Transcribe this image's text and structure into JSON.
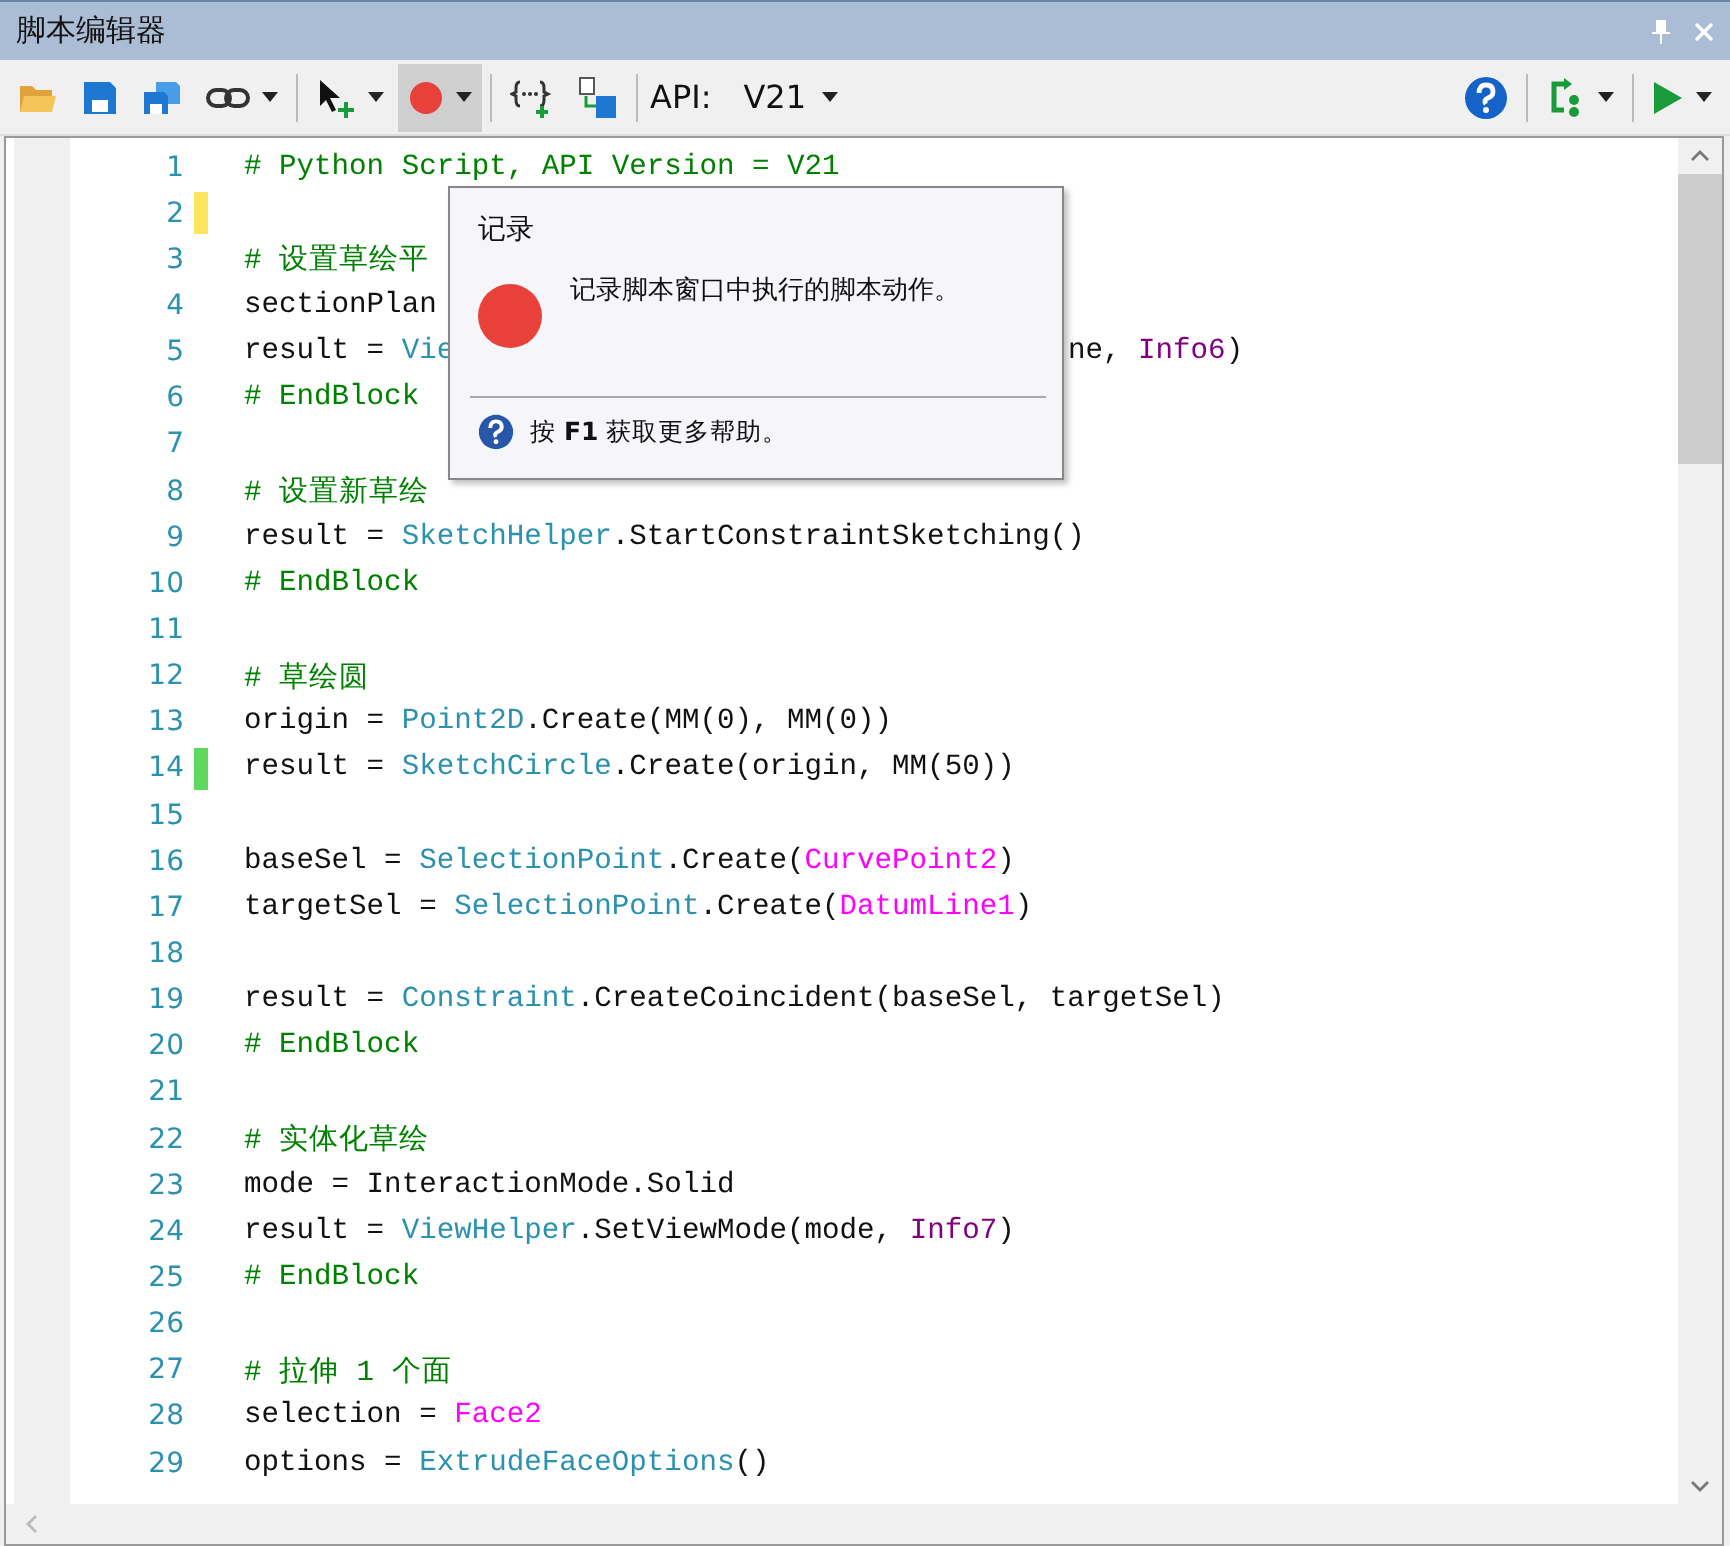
{
  "window": {
    "title": "脚本编辑器"
  },
  "toolbar": [
    {
      "kind": "open",
      "dropdown": false,
      "pressed": false
    },
    {
      "kind": "save",
      "dropdown": false,
      "pressed": false
    },
    {
      "kind": "saveall",
      "dropdown": false,
      "pressed": false
    },
    {
      "kind": "link",
      "dropdown": true,
      "pressed": false
    },
    {
      "kind": "select",
      "dropdown": true,
      "pressed": false
    },
    {
      "kind": "record",
      "dropdown": true,
      "pressed": true
    },
    {
      "kind": "insert",
      "dropdown": false,
      "pressed": false
    },
    {
      "kind": "convert",
      "dropdown": false,
      "pressed": false
    }
  ],
  "api": {
    "label": "API:",
    "version": "V21"
  },
  "toolbar_right": [
    {
      "kind": "help",
      "dropdown": false
    },
    {
      "kind": "loop",
      "dropdown": true
    },
    {
      "kind": "run",
      "dropdown": true
    }
  ],
  "lines": [
    {
      "number": "1",
      "tokens": [
        {
          "kind": "comment",
          "text": "# Python Script, API Version = V21"
        }
      ]
    },
    {
      "number": "2",
      "color": "#ffe45c"
    },
    {
      "number": "3",
      "tokens": [
        {
          "kind": "comment",
          "text": "# 设置草绘平"
        }
      ]
    },
    {
      "number": "4",
      "tokens": [
        {
          "kind": "plain",
          "text": "sectionPlan"
        }
      ]
    },
    {
      "number": "5",
      "tokens": [
        {
          "kind": "plain",
          "text": "result = "
        },
        {
          "kind": "class",
          "text": "Vie"
        }
      ],
      "tail": [
        {
          "kind": "plain",
          "text": "ne, "
        },
        {
          "kind": "info",
          "text": "Info6"
        },
        {
          "kind": "plain",
          "text": ")"
        }
      ]
    },
    {
      "number": "6",
      "tokens": [
        {
          "kind": "comment",
          "text": "# EndBlock"
        }
      ]
    },
    {
      "number": "7"
    },
    {
      "number": "8",
      "tokens": [
        {
          "kind": "comment",
          "text": "# 设置新草绘"
        }
      ]
    },
    {
      "number": "9",
      "tokens": [
        {
          "kind": "plain",
          "text": "result = "
        },
        {
          "kind": "class",
          "text": "SketchHelper"
        },
        {
          "kind": "plain",
          "text": ".StartConstraintSketching()"
        }
      ]
    },
    {
      "number": "10",
      "tokens": [
        {
          "kind": "comment",
          "text": "# EndBlock"
        }
      ]
    },
    {
      "number": "11"
    },
    {
      "number": "12",
      "tokens": [
        {
          "kind": "comment",
          "text": "# 草绘圆"
        }
      ]
    },
    {
      "number": "13",
      "tokens": [
        {
          "kind": "plain",
          "text": "origin = "
        },
        {
          "kind": "class",
          "text": "Point2D"
        },
        {
          "kind": "plain",
          "text": ".Create(MM(0), MM(0))"
        }
      ]
    },
    {
      "number": "14",
      "color": "#5ed85e",
      "tokens": [
        {
          "kind": "plain",
          "text": "result = "
        },
        {
          "kind": "class",
          "text": "SketchCircle"
        },
        {
          "kind": "plain",
          "text": ".Create(origin, MM(50))"
        }
      ]
    },
    {
      "number": "15"
    },
    {
      "number": "16",
      "tokens": [
        {
          "kind": "plain",
          "text": "baseSel = "
        },
        {
          "kind": "class",
          "text": "SelectionPoint"
        },
        {
          "kind": "plain",
          "text": ".Create("
        },
        {
          "kind": "selection",
          "text": "CurvePoint2"
        },
        {
          "kind": "plain",
          "text": ")"
        }
      ]
    },
    {
      "number": "17",
      "tokens": [
        {
          "kind": "plain",
          "text": "targetSel = "
        },
        {
          "kind": "class",
          "text": "SelectionPoint"
        },
        {
          "kind": "plain",
          "text": ".Create("
        },
        {
          "kind": "selection",
          "text": "DatumLine1"
        },
        {
          "kind": "plain",
          "text": ")"
        }
      ]
    },
    {
      "number": "18"
    },
    {
      "number": "19",
      "tokens": [
        {
          "kind": "plain",
          "text": "result = "
        },
        {
          "kind": "class",
          "text": "Constraint"
        },
        {
          "kind": "plain",
          "text": ".CreateCoincident(baseSel, targetSel)"
        }
      ]
    },
    {
      "number": "20",
      "tokens": [
        {
          "kind": "comment",
          "text": "# EndBlock"
        }
      ]
    },
    {
      "number": "21"
    },
    {
      "number": "22",
      "tokens": [
        {
          "kind": "comment",
          "text": "# 实体化草绘"
        }
      ]
    },
    {
      "number": "23",
      "tokens": [
        {
          "kind": "plain",
          "text": "mode = InteractionMode.Solid"
        }
      ]
    },
    {
      "number": "24",
      "tokens": [
        {
          "kind": "plain",
          "text": "result = "
        },
        {
          "kind": "class",
          "text": "ViewHelper"
        },
        {
          "kind": "plain",
          "text": ".SetViewMode(mode, "
        },
        {
          "kind": "info",
          "text": "Info7"
        },
        {
          "kind": "plain",
          "text": ")"
        }
      ]
    },
    {
      "number": "25",
      "tokens": [
        {
          "kind": "comment",
          "text": "# EndBlock"
        }
      ]
    },
    {
      "number": "26"
    },
    {
      "number": "27",
      "tokens": [
        {
          "kind": "comment",
          "text": "# 拉伸 1 个面"
        }
      ]
    },
    {
      "number": "28",
      "tokens": [
        {
          "kind": "plain",
          "text": "selection = "
        },
        {
          "kind": "selection",
          "text": "Face2"
        }
      ]
    },
    {
      "number": "29",
      "tokens": [
        {
          "kind": "plain",
          "text": "options = "
        },
        {
          "kind": "class",
          "text": "ExtrudeFaceOptions"
        },
        {
          "kind": "plain",
          "text": "()"
        }
      ]
    }
  ],
  "tooltip": {
    "title": "记录",
    "description": "记录脚本窗口中执行的脚本动作。",
    "help": "按 **F1** 获取更多帮助。"
  }
}
